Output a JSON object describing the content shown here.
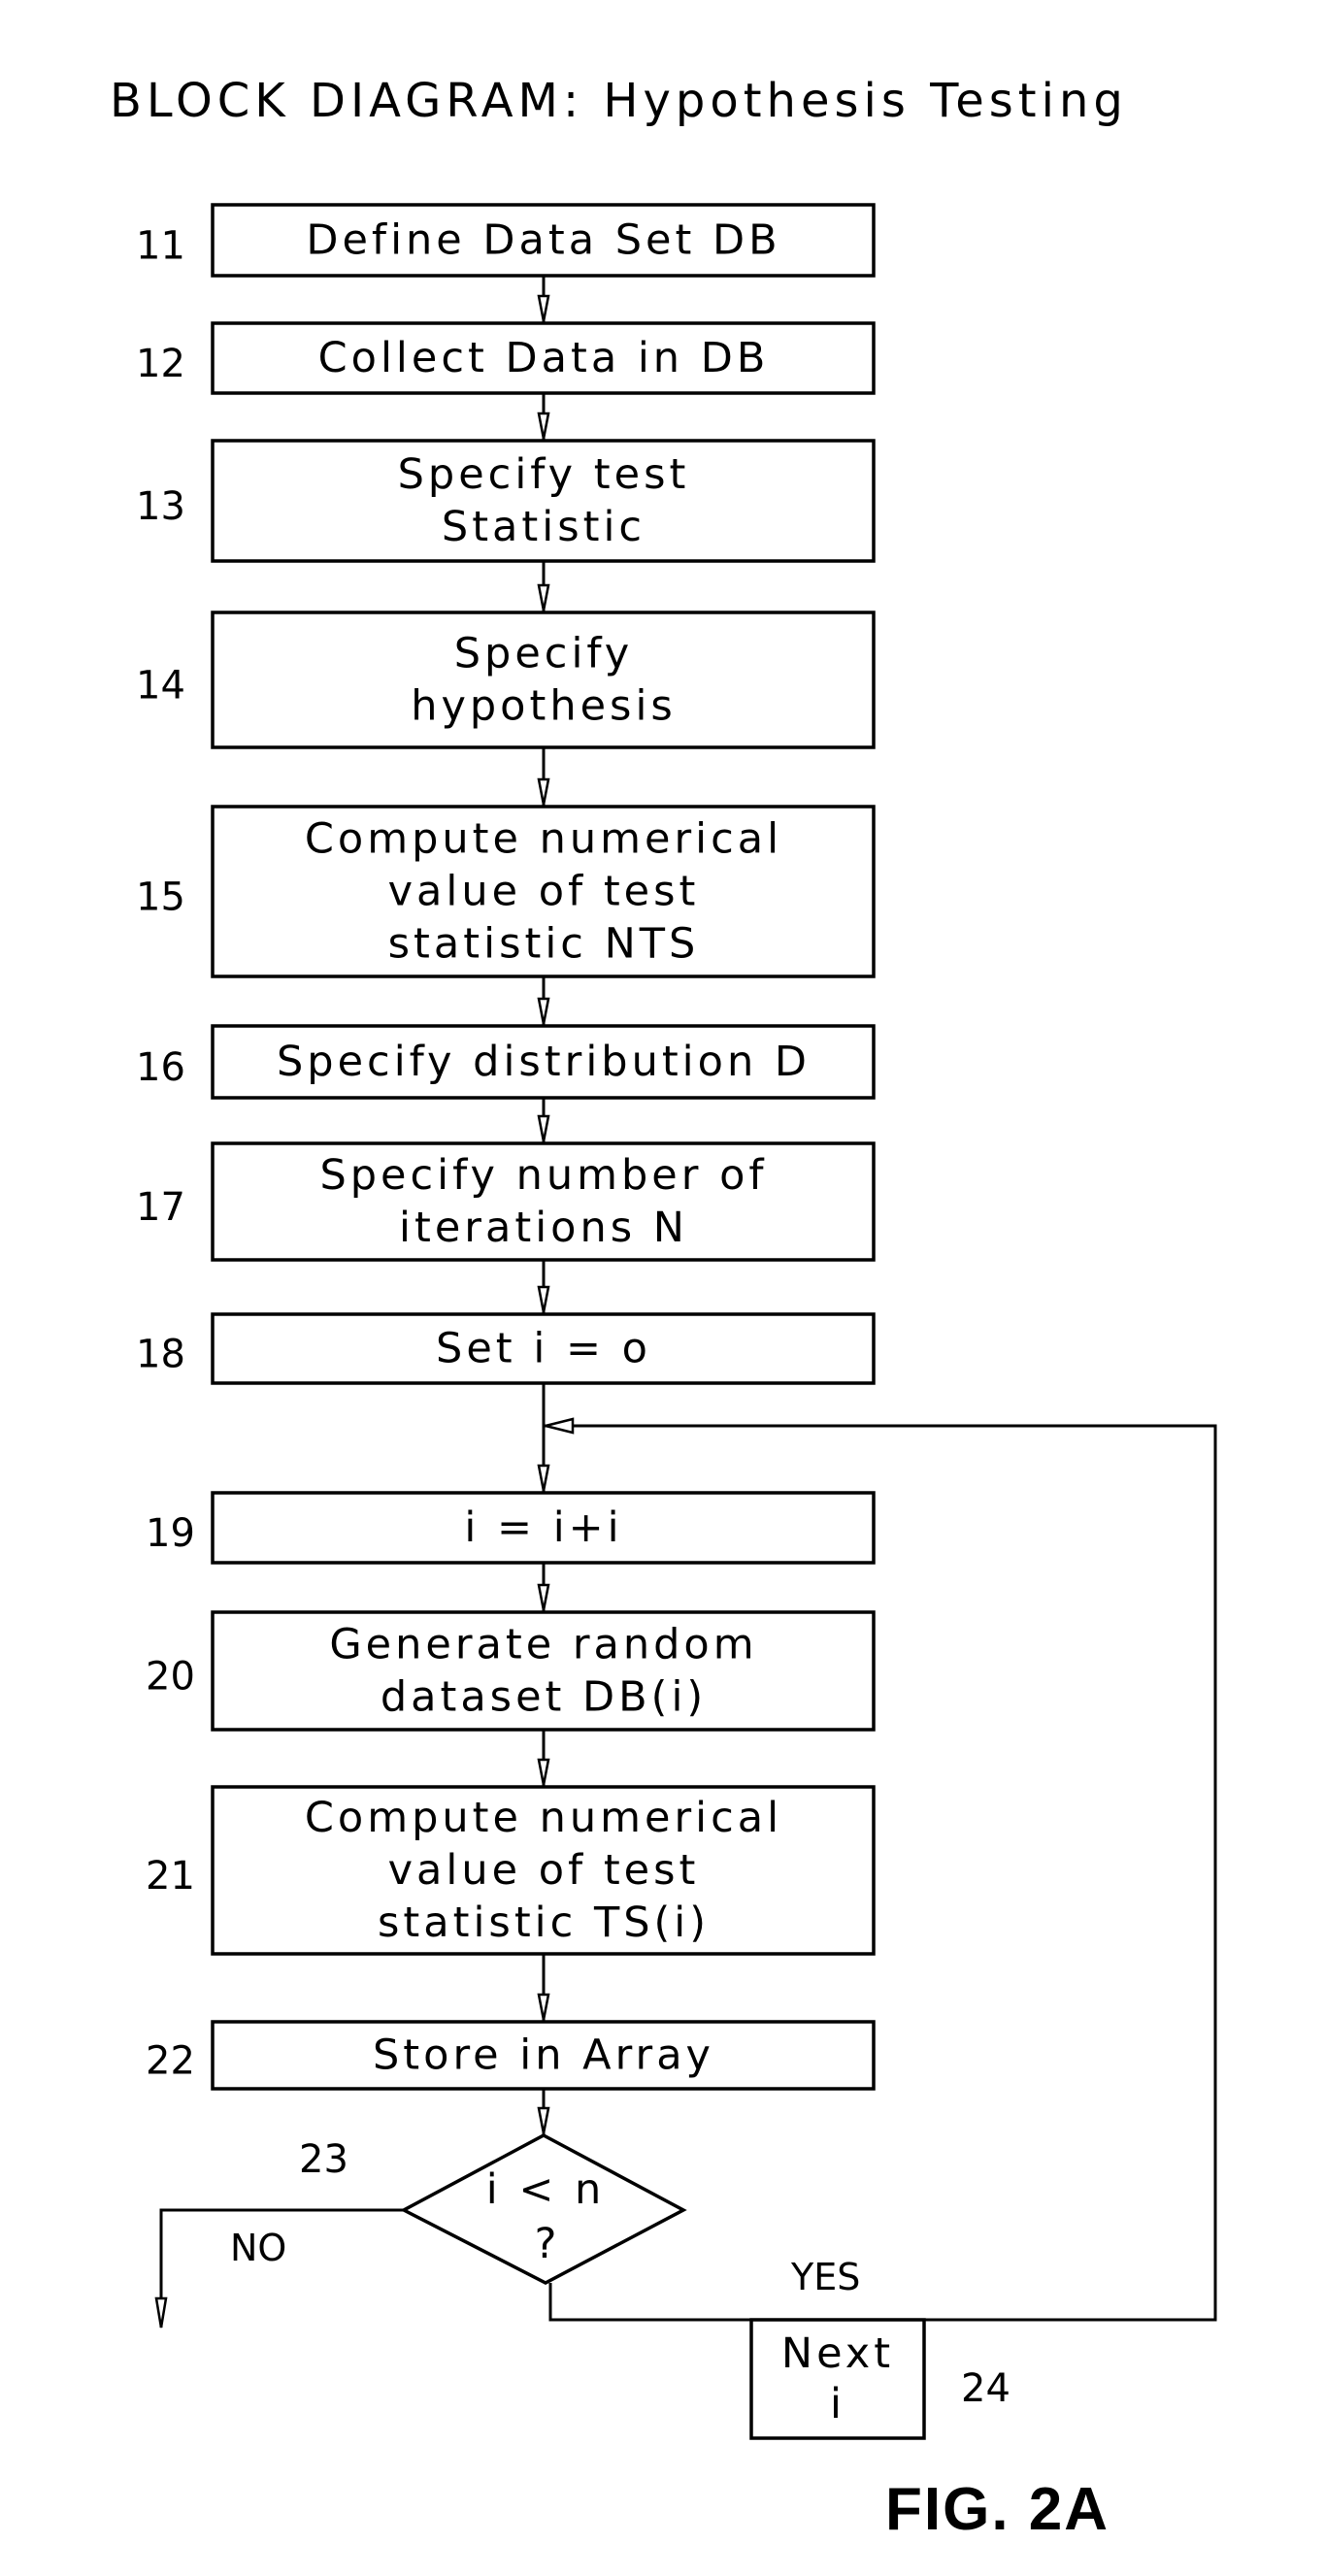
{
  "title": "BLOCK DIAGRAM: Hypothesis Testing",
  "figure_label": "FIG. 2A",
  "steps": [
    {
      "ref": "11",
      "lines": [
        "Define Data Set DB"
      ]
    },
    {
      "ref": "12",
      "lines": [
        "Collect Data in DB"
      ]
    },
    {
      "ref": "13",
      "lines": [
        "Specify test",
        "Statistic"
      ]
    },
    {
      "ref": "14",
      "lines": [
        "Specify",
        "hypothesis"
      ]
    },
    {
      "ref": "15",
      "lines": [
        "Compute numerical",
        "value of test",
        "statistic NTS"
      ]
    },
    {
      "ref": "16",
      "lines": [
        "Specify distribution D"
      ]
    },
    {
      "ref": "17",
      "lines": [
        "Specify number of",
        "iterations N"
      ]
    },
    {
      "ref": "18",
      "lines": [
        "Set i = o"
      ]
    },
    {
      "ref": "19",
      "lines": [
        "i = i+i"
      ]
    },
    {
      "ref": "20",
      "lines": [
        "Generate random",
        "dataset DB(i)"
      ]
    },
    {
      "ref": "21",
      "lines": [
        "Compute numerical",
        "value of test",
        "statistic TS(i)"
      ]
    },
    {
      "ref": "22",
      "lines": [
        "Store in Array"
      ]
    }
  ],
  "decision": {
    "ref": "23",
    "lines": [
      "i < n",
      "?"
    ],
    "no_label": "NO",
    "yes_label": "YES"
  },
  "next_box": {
    "ref": "24",
    "lines": [
      "Next",
      "i"
    ]
  }
}
